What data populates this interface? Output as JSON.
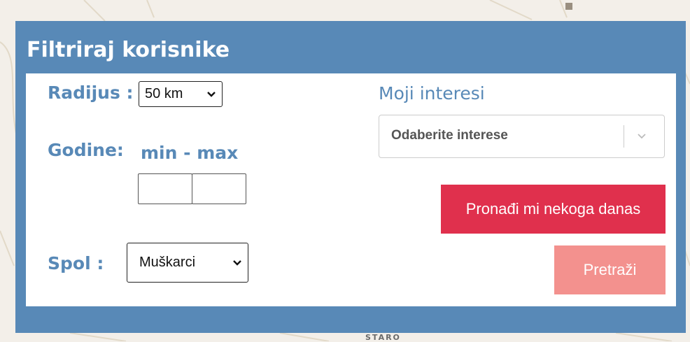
{
  "panel": {
    "title": "Filtriraj korisnike"
  },
  "filters": {
    "radius_label": "Radijus :",
    "radius_value": "50 km",
    "age_label": "Godine:",
    "age_hint": "min - max",
    "min_value": "",
    "max_value": "",
    "gender_label": "Spol :",
    "gender_value": "Muškarci"
  },
  "interests": {
    "label": "Moji interesi",
    "placeholder": "Odaberite interese"
  },
  "buttons": {
    "find_label": "Pronađi mi nekoga danas",
    "search_label": "Pretraži"
  },
  "map": {
    "label": "STARO"
  },
  "colors": {
    "panel": "#5889b7",
    "find_button": "#e0304d",
    "search_button": "#f3918e"
  }
}
